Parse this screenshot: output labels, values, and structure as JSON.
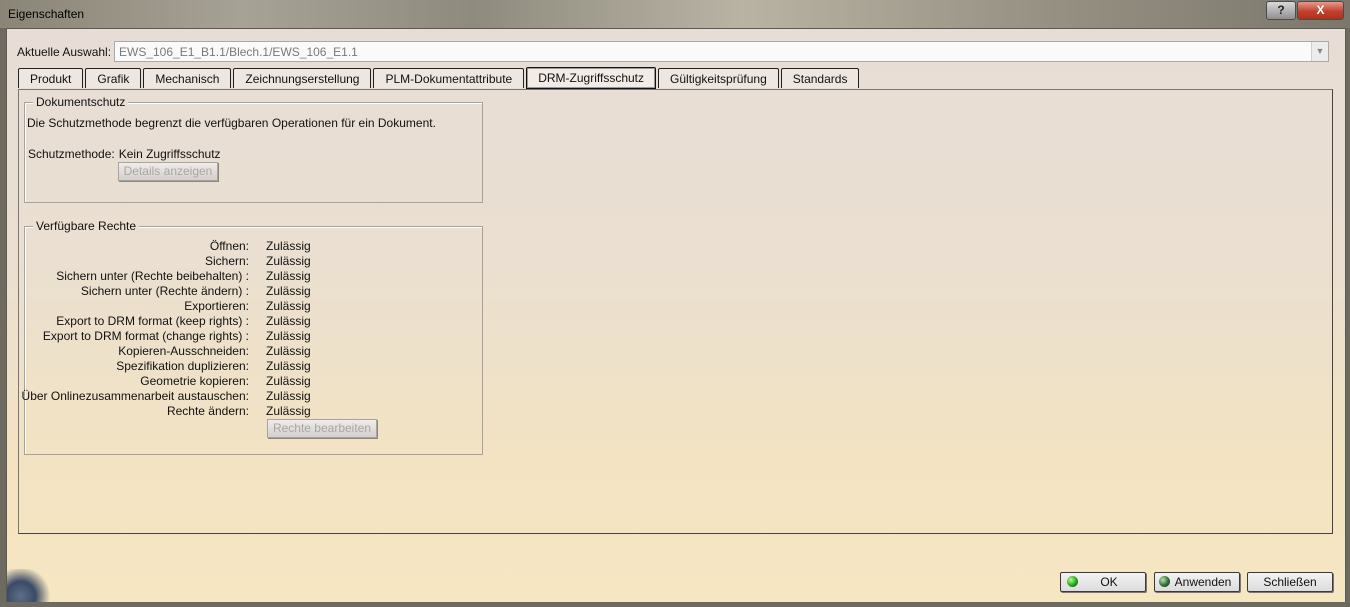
{
  "window": {
    "title": "Eigenschaften",
    "help_label": "?",
    "close_label": "X"
  },
  "selection": {
    "label": "Aktuelle Auswahl:",
    "value": "EWS_106_E1_B1.1/Blech.1/EWS_106_E1.1"
  },
  "tabs": [
    {
      "label": "Produkt"
    },
    {
      "label": "Grafik"
    },
    {
      "label": "Mechanisch"
    },
    {
      "label": "Zeichnungserstellung"
    },
    {
      "label": "PLM-Dokumentattribute"
    },
    {
      "label": "DRM-Zugriffsschutz",
      "active": true
    },
    {
      "label": "Gültigkeitsprüfung"
    },
    {
      "label": "Standards"
    }
  ],
  "dokumentschutz": {
    "legend": "Dokumentschutz",
    "description": "Die Schutzmethode begrenzt die verfügbaren Operationen für ein Dokument.",
    "method_label": "Schutzmethode:",
    "method_value": "Kein Zugriffsschutz",
    "details_button": "Details anzeigen"
  },
  "rechte": {
    "legend": "Verfügbare Rechte",
    "items": [
      {
        "label": "Öffnen:",
        "value": "Zulässig"
      },
      {
        "label": "Sichern:",
        "value": "Zulässig"
      },
      {
        "label": "Sichern unter (Rechte beibehalten) :",
        "value": "Zulässig"
      },
      {
        "label": "Sichern unter (Rechte ändern) :",
        "value": "Zulässig"
      },
      {
        "label": "Exportieren:",
        "value": "Zulässig"
      },
      {
        "label": "Export to DRM format (keep rights) :",
        "value": "Zulässig"
      },
      {
        "label": "Export to DRM format (change rights) :",
        "value": "Zulässig"
      },
      {
        "label": "Kopieren-Ausschneiden:",
        "value": "Zulässig"
      },
      {
        "label": "Spezifikation duplizieren:",
        "value": "Zulässig"
      },
      {
        "label": "Geometrie kopieren:",
        "value": "Zulässig"
      },
      {
        "label": "Über Onlinezusammenarbeit austauschen:",
        "value": "Zulässig"
      },
      {
        "label": "Rechte ändern:",
        "value": "Zulässig"
      }
    ],
    "edit_button": "Rechte bearbeiten"
  },
  "buttons": {
    "ok": "OK",
    "apply": "Anwenden",
    "close": "Schließen"
  }
}
